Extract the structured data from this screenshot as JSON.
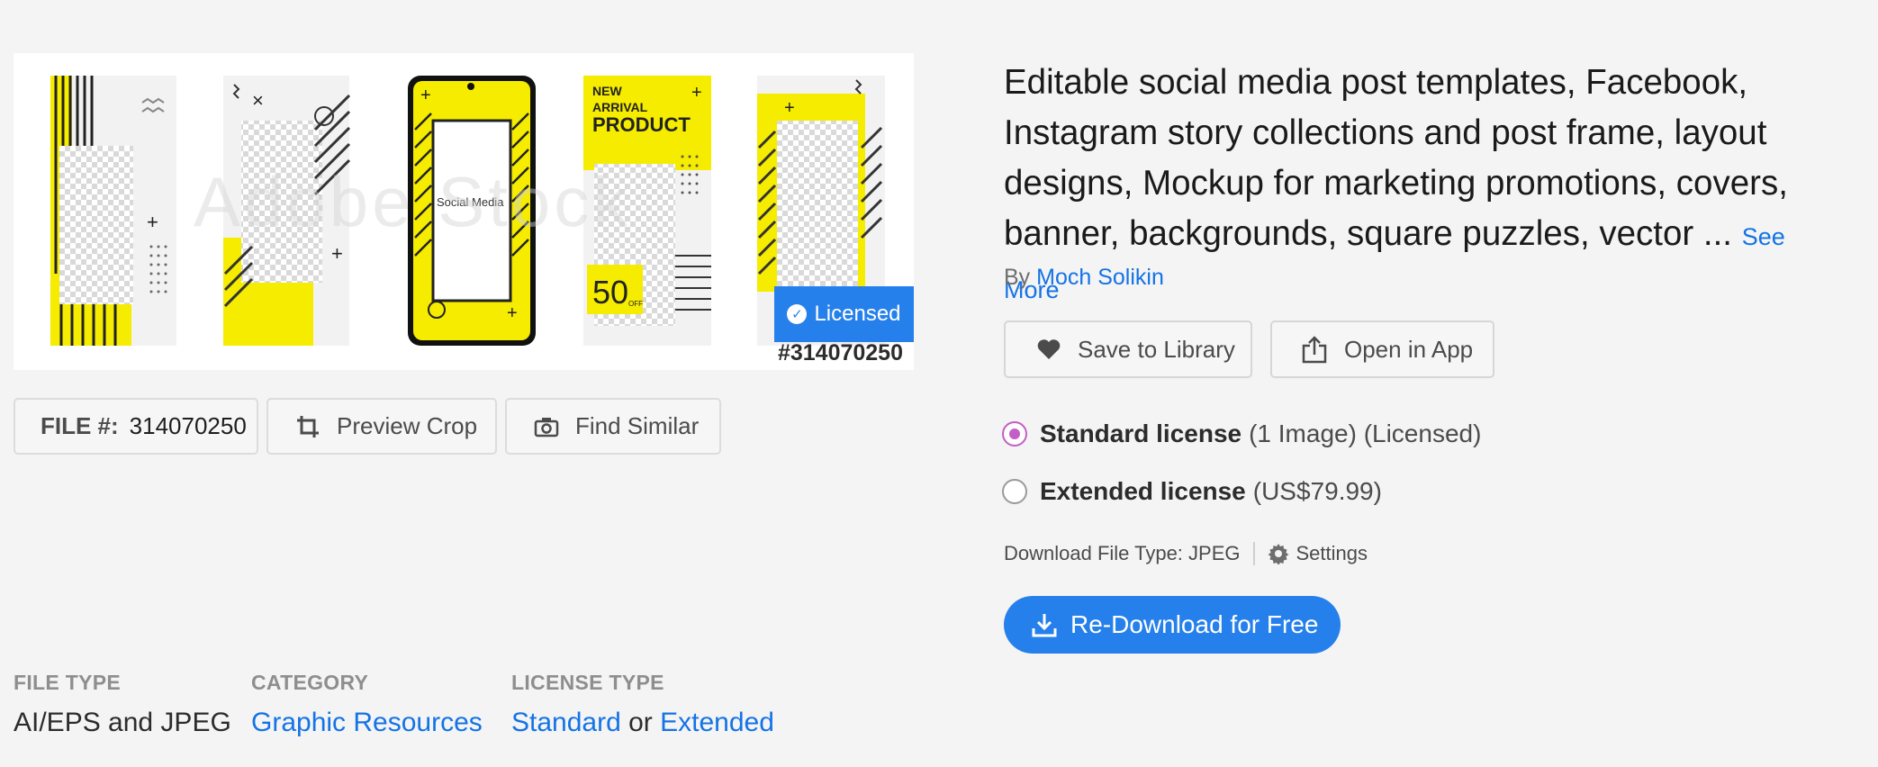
{
  "preview": {
    "watermark": "Adobe Stock",
    "badge_label": "Licensed",
    "file_overlay": "#314070250",
    "thumb2_text": "Social Media",
    "thumb3_line1": "NEW",
    "thumb3_line2": "ARRIVAL",
    "thumb3_line3": "PRODUCT",
    "thumb3_sale": "50",
    "thumb3_sale_suffix": "OFF",
    "accent_color": "#f5ec00"
  },
  "actions": {
    "file_label": "FILE #:",
    "file_number": "314070250",
    "preview_crop": "Preview Crop",
    "find_similar": "Find Similar"
  },
  "meta": {
    "file_type_head": "FILE TYPE",
    "file_type_value": "AI/EPS and JPEG",
    "category_head": "CATEGORY",
    "category_value": "Graphic Resources",
    "license_type_head": "LICENSE TYPE",
    "license_standard": "Standard",
    "license_or": "or",
    "license_extended": "Extended"
  },
  "details": {
    "title": "Editable social media post templates, Facebook, Instagram story collections and post frame, layout designs, Mockup for marketing promotions, covers, banner, backgrounds, square puzzles, vector ...",
    "see_more": "See More",
    "by_label": "By",
    "author": "Moch Solikin",
    "save_library": "Save to Library",
    "open_in_app": "Open in App"
  },
  "licenses": {
    "standard_label": "Standard license",
    "standard_sub": "(1 Image) (Licensed)",
    "extended_label": "Extended license",
    "extended_sub": "(US$79.99)",
    "selected": "standard"
  },
  "download": {
    "file_type_text": "Download File Type: JPEG",
    "settings_label": "Settings",
    "redownload_label": "Re-Download for Free",
    "button_color": "#2680eb"
  }
}
